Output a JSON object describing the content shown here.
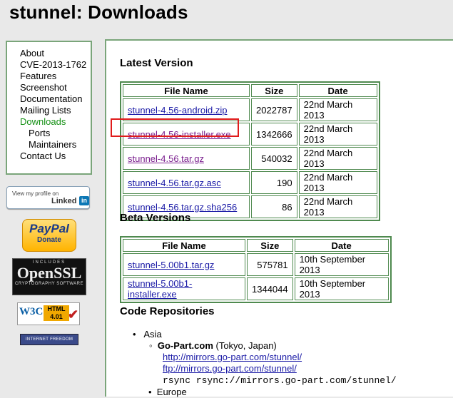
{
  "page": {
    "title": "stunnel: Downloads"
  },
  "menu": {
    "items": [
      {
        "label": "About"
      },
      {
        "label": "CVE-2013-1762"
      },
      {
        "label": "Features"
      },
      {
        "label": "Screenshot"
      },
      {
        "label": "Documentation"
      },
      {
        "label": "Mailing Lists"
      },
      {
        "label": "Downloads"
      },
      {
        "label": "Ports"
      },
      {
        "label": "Maintainers"
      },
      {
        "label": "Contact Us"
      }
    ]
  },
  "badges": {
    "linkedin": {
      "line1": "View my profile on",
      "brand": "Linked",
      "in": "in"
    },
    "paypal": {
      "brand": "PayPal",
      "action": "Donate"
    },
    "openssl": {
      "top": "INCLUDES",
      "name": "OpenSSL",
      "bottom": "CRYPTOGRAPHY SOFTWARE"
    },
    "w3c": {
      "logo": "W3C",
      "html": "HTML 4.01"
    },
    "freedom": {
      "label": "INTERNET FREEDOM"
    }
  },
  "latest": {
    "heading": "Latest Version",
    "columns": [
      "File Name",
      "Size",
      "Date"
    ],
    "rows": [
      {
        "name": "stunnel-4.56-android.zip",
        "size": "2022787",
        "date": "22nd March 2013"
      },
      {
        "name": "stunnel-4.56-installer.exe",
        "size": "1342666",
        "date": "22nd March 2013"
      },
      {
        "name": "stunnel-4.56.tar.gz",
        "size": "540032",
        "date": "22nd March 2013"
      },
      {
        "name": "stunnel-4.56.tar.gz.asc",
        "size": "190",
        "date": "22nd March 2013"
      },
      {
        "name": "stunnel-4.56.tar.gz.sha256",
        "size": "86",
        "date": "22nd March 2013"
      }
    ]
  },
  "beta": {
    "heading": "Beta Versions",
    "columns": [
      "File Name",
      "Size",
      "Date"
    ],
    "rows": [
      {
        "name": "stunnel-5.00b1.tar.gz",
        "size": "575781",
        "date": "10th September 2013"
      },
      {
        "name": "stunnel-5.00b1-installer.exe",
        "size": "1344044",
        "date": "10th September 2013"
      }
    ]
  },
  "repos": {
    "heading": "Code Repositories",
    "region": "Asia",
    "mirror_name": "Go-Part.com",
    "mirror_loc": "(Tokyo, Japan)",
    "http": "http://mirrors.go-part.com/stunnel/",
    "ftp": "ftp://mirrors.go-part.com/stunnel/",
    "rsync": "rsync rsync://mirrors.go-part.com/stunnel/",
    "next_region": "Europe"
  },
  "colors": {
    "border_green": "#4f8a4f",
    "highlight_red": "#e01b1b",
    "link_blue": "#1a1aa6",
    "link_visited": "#7a1e8e"
  }
}
